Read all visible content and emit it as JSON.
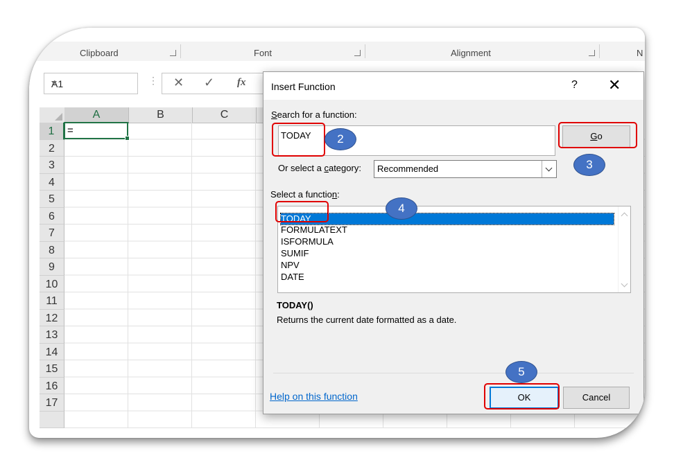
{
  "ribbon": {
    "groups": [
      "Clipboard",
      "Font",
      "Alignment",
      "N"
    ]
  },
  "formula_bar": {
    "name_box": "A1",
    "cancel_symbol": "✕",
    "enter_symbol": "✓",
    "fx_symbol": "fx"
  },
  "sheet": {
    "columns": [
      "A",
      "B",
      "C"
    ],
    "rows": [
      "1",
      "2",
      "3",
      "4",
      "5",
      "6",
      "7",
      "8",
      "9",
      "10",
      "11",
      "12",
      "13",
      "14",
      "15",
      "16",
      "17"
    ],
    "active_cell_value": "="
  },
  "dialog": {
    "title": "Insert Function",
    "help_symbol": "?",
    "close_symbol": "✕",
    "search_label_key": "S",
    "search_label_rest": "earch for a function:",
    "search_value": "TODAY",
    "go_key": "G",
    "go_rest": "o",
    "category_label_pre": "Or select a ",
    "category_label_key": "c",
    "category_label_post": "ategory:",
    "category_value": "Recommended",
    "select_label_pre": "Select a functio",
    "select_label_key": "n",
    "select_label_post": ":",
    "functions": [
      "TODAY",
      "FORMULATEXT",
      "ISFORMULA",
      "SUMIF",
      "NPV",
      "DATE"
    ],
    "selected_index": 0,
    "signature": "TODAY()",
    "description": "Returns the current date formatted as a date.",
    "help_link": "Help on this function",
    "ok_label": "OK",
    "cancel_label": "Cancel"
  },
  "annotations": [
    "2",
    "3",
    "4",
    "5"
  ],
  "colors": {
    "excel_green": "#217346",
    "selection_blue": "#0078d7",
    "annotation_red": "#e00000",
    "badge_blue": "#4472c4"
  }
}
